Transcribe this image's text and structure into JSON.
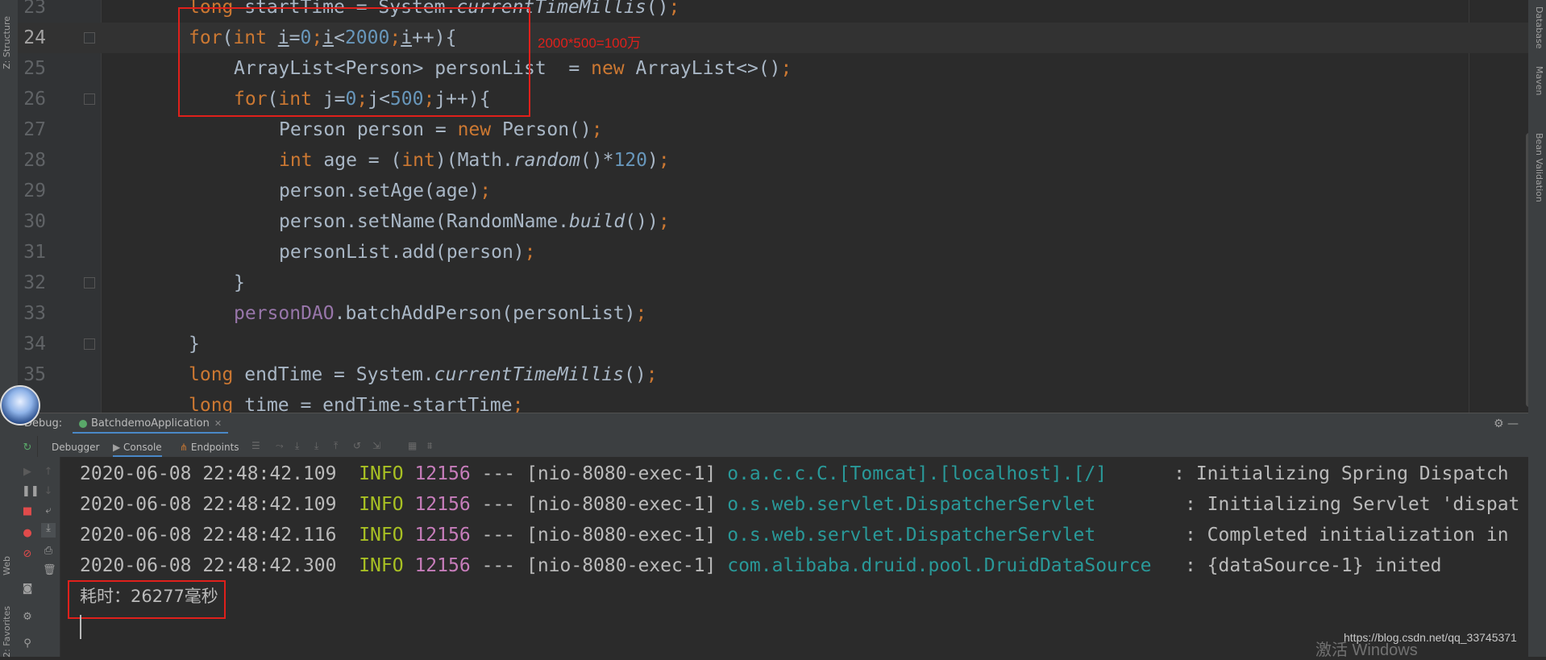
{
  "left_panel": {
    "structure": "Z: Structure",
    "web": "Web",
    "favorites": "2: Favorites"
  },
  "right_panel": {
    "database": "Database",
    "maven": "Maven",
    "bean_validation": "Bean Validation"
  },
  "editor": {
    "line_numbers": [
      "23",
      "24",
      "25",
      "26",
      "27",
      "28",
      "29",
      "30",
      "31",
      "32",
      "33",
      "34",
      "35"
    ],
    "caret_line": "24",
    "annotation": "2000*500=100万"
  },
  "debug": {
    "label": "Debug:",
    "session": "BatchdemoApplication",
    "tabs": {
      "debugger": "Debugger",
      "console": "Console",
      "endpoints": "Endpoints"
    }
  },
  "console": {
    "lines": [
      {
        "ts": "2020-06-08 22:48:42.109",
        "level": "INFO",
        "pid": "12156",
        "sep": "---",
        "thread": "[nio-8080-exec-1]",
        "logger": "o.a.c.c.C.[Tomcat].[localhost].[/]     ",
        "msg": ": Initializing Spring Dispatch"
      },
      {
        "ts": "2020-06-08 22:48:42.109",
        "level": "INFO",
        "pid": "12156",
        "sep": "---",
        "thread": "[nio-8080-exec-1]",
        "logger": "o.s.web.servlet.DispatcherServlet       ",
        "msg": ": Initializing Servlet 'dispat"
      },
      {
        "ts": "2020-06-08 22:48:42.116",
        "level": "INFO",
        "pid": "12156",
        "sep": "---",
        "thread": "[nio-8080-exec-1]",
        "logger": "o.s.web.servlet.DispatcherServlet       ",
        "msg": ": Completed initialization in"
      },
      {
        "ts": "2020-06-08 22:48:42.300",
        "level": "INFO",
        "pid": "12156",
        "sep": "---",
        "thread": "[nio-8080-exec-1]",
        "logger": "com.alibaba.druid.pool.DruidDataSource  ",
        "msg": ": {dataSource-1} inited"
      }
    ],
    "elapsed": "耗时：26277毫秒"
  },
  "watermark": {
    "url": "https://blog.csdn.net/qq_33745371",
    "activate": "激活 Windows"
  },
  "colors": {
    "keyword": "#cc7832",
    "number": "#6897bb",
    "field": "#9876aa",
    "info": "#a8c023",
    "logger": "#299999",
    "annotation": "#e0201b"
  }
}
